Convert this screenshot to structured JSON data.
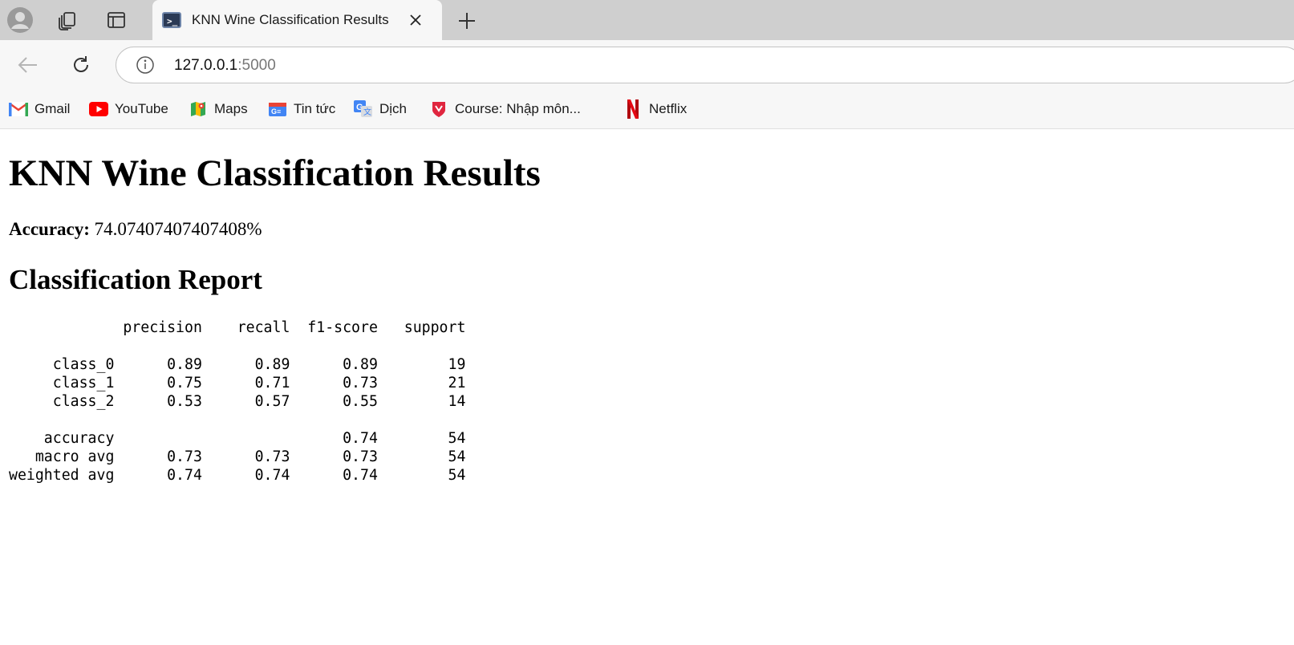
{
  "browser": {
    "tab": {
      "title": "KNN Wine Classification Results",
      "favicon": "terminal-icon"
    },
    "address": {
      "host": "127.0.0.1",
      "port": ":5000"
    },
    "bookmarks": [
      {
        "label": "Gmail",
        "icon": "gmail-icon"
      },
      {
        "label": "YouTube",
        "icon": "youtube-icon"
      },
      {
        "label": "Maps",
        "icon": "maps-icon"
      },
      {
        "label": "Tin tức",
        "icon": "news-icon"
      },
      {
        "label": "Dịch",
        "icon": "translate-icon"
      },
      {
        "label": "Course: Nhập môn...",
        "icon": "course-icon"
      },
      {
        "label": "Netflix",
        "icon": "netflix-icon"
      }
    ]
  },
  "page": {
    "heading": "KNN Wine Classification Results",
    "accuracy_label": "Accuracy:",
    "accuracy_value": "74.07407407407408%",
    "report_heading": "Classification Report",
    "report": {
      "columns": [
        "precision",
        "recall",
        "f1-score",
        "support"
      ],
      "rows": [
        {
          "label": "class_0",
          "precision": "0.89",
          "recall": "0.89",
          "f1": "0.89",
          "support": "19"
        },
        {
          "label": "class_1",
          "precision": "0.75",
          "recall": "0.71",
          "f1": "0.73",
          "support": "21"
        },
        {
          "label": "class_2",
          "precision": "0.53",
          "recall": "0.57",
          "f1": "0.55",
          "support": "14"
        }
      ],
      "summary": [
        {
          "label": "accuracy",
          "precision": "",
          "recall": "",
          "f1": "0.74",
          "support": "54"
        },
        {
          "label": "macro avg",
          "precision": "0.73",
          "recall": "0.73",
          "f1": "0.73",
          "support": "54"
        },
        {
          "label": "weighted avg",
          "precision": "0.74",
          "recall": "0.74",
          "f1": "0.74",
          "support": "54"
        }
      ]
    }
  }
}
